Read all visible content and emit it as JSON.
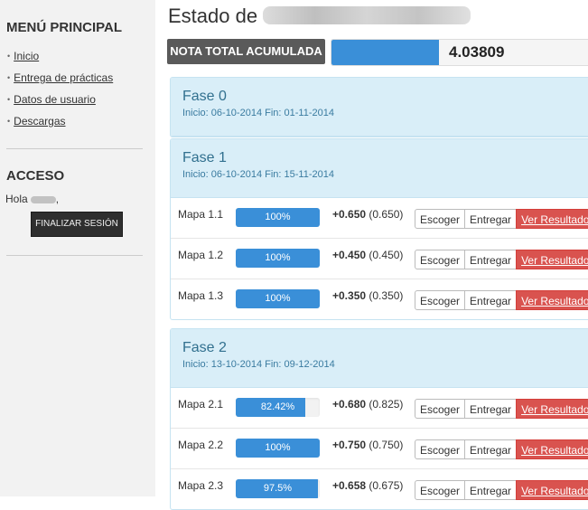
{
  "sidebar": {
    "menu_title": "MENÚ PRINCIPAL",
    "menu_items": [
      {
        "label": "Inicio"
      },
      {
        "label": "Entrega de prácticas"
      },
      {
        "label": "Datos de usuario"
      },
      {
        "label": "Descargas"
      }
    ],
    "access_title": "ACCESO",
    "greeting": "Hola",
    "greeting_suffix": ",",
    "logout_label": "FINALIZAR SESIÓN"
  },
  "main": {
    "title": "Estado de",
    "total_label": "NOTA TOTAL ACUMULADA",
    "total_value": "4.03809",
    "buttons": {
      "choose": "Escoger",
      "submit": "Entregar",
      "results": "Ver Resultados"
    },
    "fases": [
      {
        "title": "Fase 0",
        "dates": "Inicio: 06-10-2014 Fin: 01-11-2014",
        "rows": []
      },
      {
        "title": "Fase 1",
        "dates": "Inicio: 06-10-2014 Fin: 15-11-2014",
        "rows": [
          {
            "name": "Mapa 1.1",
            "progress": 100,
            "progress_label": "100%",
            "score": "+0.650",
            "max": "(0.650)"
          },
          {
            "name": "Mapa 1.2",
            "progress": 100,
            "progress_label": "100%",
            "score": "+0.450",
            "max": "(0.450)"
          },
          {
            "name": "Mapa 1.3",
            "progress": 100,
            "progress_label": "100%",
            "score": "+0.350",
            "max": "(0.350)"
          }
        ]
      },
      {
        "title": "Fase 2",
        "dates": "Inicio: 13-10-2014 Fin: 09-12-2014",
        "rows": [
          {
            "name": "Mapa 2.1",
            "progress": 82.42,
            "progress_label": "82.42%",
            "score": "+0.680",
            "max": "(0.825)"
          },
          {
            "name": "Mapa 2.2",
            "progress": 100,
            "progress_label": "100%",
            "score": "+0.750",
            "max": "(0.750)"
          },
          {
            "name": "Mapa 2.3",
            "progress": 97.5,
            "progress_label": "97.5%",
            "score": "+0.658",
            "max": "(0.675)"
          }
        ]
      }
    ]
  },
  "colors": {
    "progress_blue": "#3a8fd8",
    "results_red": "#d9534f",
    "fase_header": "#d9eef8",
    "sidebar_bg": "#f2f2f2"
  }
}
